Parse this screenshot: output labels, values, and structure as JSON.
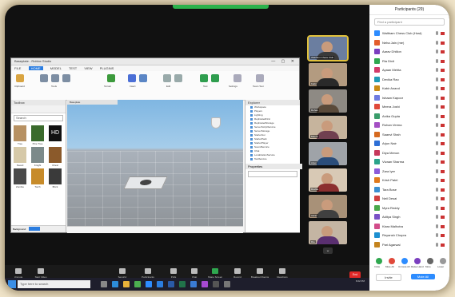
{
  "zoom": {
    "participants_panel": {
      "title": "Participants (29)",
      "search_placeholder": "Find a participant",
      "participants": [
        {
          "name": "Waltham Chess Club (Host)",
          "avatar_color": "#2d8cff"
        },
        {
          "name": "Neha Jain (me)",
          "avatar_color": "#e35d2b"
        },
        {
          "name": "Aarav Dhillon",
          "avatar_color": "#7b3fbf"
        },
        {
          "name": "Ria Dixit",
          "avatar_color": "#2fa84f"
        },
        {
          "name": "Ayaan Mehta",
          "avatar_color": "#d23b6a"
        },
        {
          "name": "Devika Rao",
          "avatar_color": "#1f9bb5"
        },
        {
          "name": "Kabir Anand",
          "avatar_color": "#c98a15"
        },
        {
          "name": "Ishaan Kapoor",
          "avatar_color": "#6f7be0"
        },
        {
          "name": "Meera Joshi",
          "avatar_color": "#e0493a"
        },
        {
          "name": "Anika Gupta",
          "avatar_color": "#3a9d6b"
        },
        {
          "name": "Rohan Verma",
          "avatar_color": "#a44fc4"
        },
        {
          "name": "Saanvi Shah",
          "avatar_color": "#d66a1f"
        },
        {
          "name": "Arjun Nair",
          "avatar_color": "#2d6fd6"
        },
        {
          "name": "Diya Menon",
          "avatar_color": "#c7385b"
        },
        {
          "name": "Vivaan Sharma",
          "avatar_color": "#2aa38a"
        },
        {
          "name": "Zara Iyer",
          "avatar_color": "#8c5bd9"
        },
        {
          "name": "Krish Patel",
          "avatar_color": "#e07a1d"
        },
        {
          "name": "Tara Bose",
          "avatar_color": "#3b8fd1"
        },
        {
          "name": "Neil Desai",
          "avatar_color": "#cf3f3f"
        },
        {
          "name": "Myra Reddy",
          "avatar_color": "#4aa84a"
        },
        {
          "name": "Aditya Singh",
          "avatar_color": "#7a52c7"
        },
        {
          "name": "Kiara Malhotra",
          "avatar_color": "#d24d8a"
        },
        {
          "name": "Reyansh Chopra",
          "avatar_color": "#1d8fd0"
        },
        {
          "name": "Pari Agarwal",
          "avatar_color": "#c4841e"
        }
      ],
      "actions": [
        "Invite",
        "Mute All",
        "Unmute All",
        "Raise Hand",
        "More",
        "Lower"
      ],
      "bottom_buttons": [
        "Invite",
        "Mute All"
      ]
    },
    "video_strip": {
      "tiles": [
        {
          "name": "Waltham Chess Club",
          "bg": "#6b7ea0",
          "shirt": "#3a3a3a",
          "active": true
        },
        {
          "name": "Kabir",
          "bg": "#b39b80",
          "shirt": "#2a2a2a",
          "active": false
        },
        {
          "name": "Rohan",
          "bg": "#8e8a84",
          "shirt": "#5a4a3a",
          "active": false
        },
        {
          "name": "Meera",
          "bg": "#c6b49d",
          "shirt": "#704050",
          "active": false
        },
        {
          "name": "Arjun",
          "bg": "#9fa3a8",
          "shirt": "#2b4d7a",
          "active": false
        },
        {
          "name": "Devika",
          "bg": "#d8c9b5",
          "shirt": "#8c2f2f",
          "active": false
        },
        {
          "name": "Aarav",
          "bg": "#a89178",
          "shirt": "#404040",
          "active": false
        },
        {
          "name": "Ria",
          "bg": "#c4b5a3",
          "shirt": "#5a2f70",
          "active": false
        }
      ]
    },
    "toolbar": {
      "items": [
        {
          "label": "Unmute"
        },
        {
          "label": "Start Video"
        },
        {
          "label": "Security"
        },
        {
          "label": "Participants"
        },
        {
          "label": "Polls"
        },
        {
          "label": "Chat"
        },
        {
          "label": "Share Screen"
        },
        {
          "label": "Record"
        },
        {
          "label": "Breakout Rooms"
        },
        {
          "label": "Reactions"
        }
      ],
      "end_label": "End"
    }
  },
  "studio": {
    "title": "Baseplate - Roblox Studio",
    "menu": [
      "FILE",
      "HOME",
      "MODEL",
      "TEST",
      "VIEW",
      "PLUGINS"
    ],
    "ribbon_groups": [
      "Clipboard",
      "Tools",
      "Terrain",
      "Insert",
      "Edit",
      "Test",
      "Settings",
      "Team Test"
    ],
    "toolbox": {
      "title": "Toolbox",
      "search_placeholder": "Search",
      "items": [
        "Tree",
        "Pine Tree",
        "Car",
        "HD Admin",
        "Sword",
        "Knight",
        "Lamp",
        "Chest",
        "Zombie",
        "Torch",
        "Brick"
      ],
      "footer_label": "Background:"
    },
    "viewport_tab": "Baseplate",
    "explorer": {
      "title": "Explorer",
      "items": [
        "Workspace",
        "Players",
        "Lighting",
        "ReplicatedFirst",
        "ReplicatedStorage",
        "ServerScriptService",
        "ServerStorage",
        "StarterGui",
        "StarterPack",
        "StarterPlayer",
        "SoundService",
        "Chat",
        "LocalizationService",
        "TestService"
      ]
    },
    "properties": {
      "title": "Properties",
      "filter_placeholder": "Filter Properties (Ctrl+Shift+P)"
    }
  },
  "taskbar": {
    "search_placeholder": "Type here to search",
    "apps": [
      {
        "name": "task-view",
        "color": "#888"
      },
      {
        "name": "edge",
        "color": "#2d8cd8"
      },
      {
        "name": "explorer",
        "color": "#e8b23a"
      },
      {
        "name": "chrome",
        "color": "#4caf50"
      },
      {
        "name": "zoom",
        "color": "#2d8cff"
      },
      {
        "name": "roblox-studio",
        "color": "#2b7de0"
      },
      {
        "name": "word",
        "color": "#2a5aa8"
      },
      {
        "name": "excel",
        "color": "#21734a"
      },
      {
        "name": "mail",
        "color": "#3a7bd5"
      },
      {
        "name": "photos",
        "color": "#a64ad1"
      },
      {
        "name": "store",
        "color": "#555"
      },
      {
        "name": "settings",
        "color": "#777"
      }
    ],
    "clock": "6:02 PM"
  }
}
